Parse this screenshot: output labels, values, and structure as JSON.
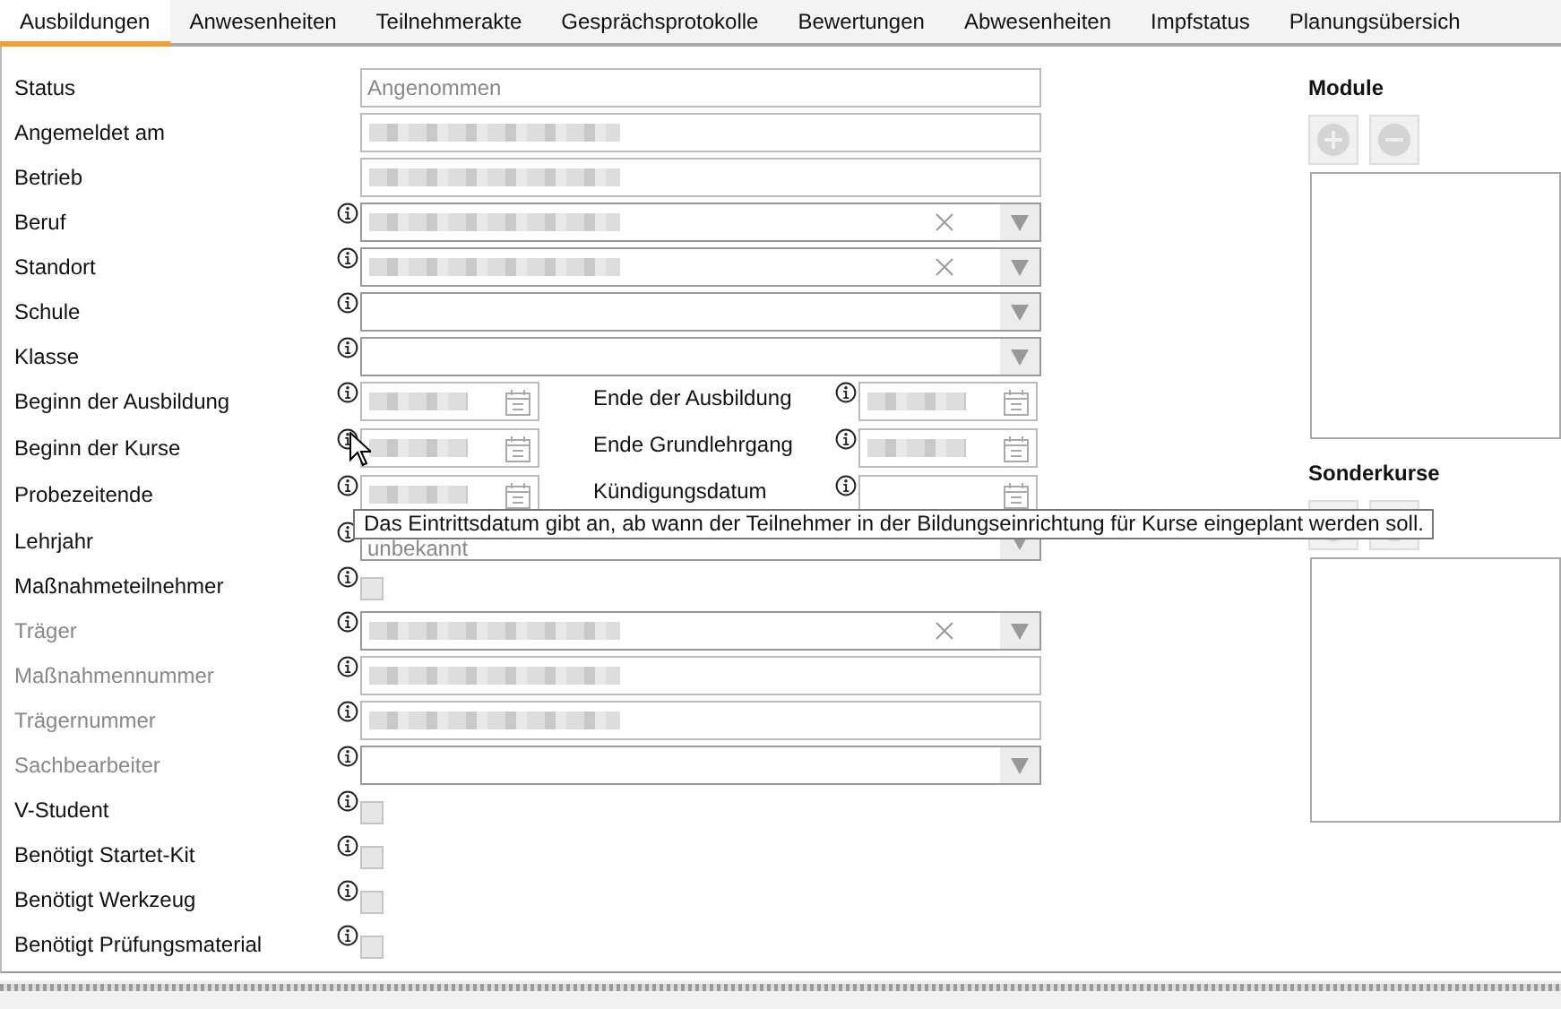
{
  "tabs": [
    {
      "label": "Ausbildungen",
      "selected": true
    },
    {
      "label": "Anwesenheiten",
      "selected": false
    },
    {
      "label": "Teilnehmerakte",
      "selected": false
    },
    {
      "label": "Gesprächsprotokolle",
      "selected": false
    },
    {
      "label": "Bewertungen",
      "selected": false
    },
    {
      "label": "Abwesenheiten",
      "selected": false
    },
    {
      "label": "Impfstatus",
      "selected": false
    },
    {
      "label": "Planungsübersich",
      "selected": false
    }
  ],
  "form": [
    {
      "label": "Status",
      "disabled": false,
      "info": false,
      "field": {
        "kind": "text",
        "value": "Angenommen"
      }
    },
    {
      "label": "Angemeldet am",
      "disabled": false,
      "info": false,
      "field": {
        "kind": "text",
        "redacted": true
      }
    },
    {
      "label": "Betrieb",
      "disabled": false,
      "info": false,
      "field": {
        "kind": "text",
        "redacted": true
      }
    },
    {
      "label": "Beruf",
      "disabled": false,
      "info": true,
      "field": {
        "kind": "combo",
        "redacted": true,
        "clearable": true
      }
    },
    {
      "label": "Standort",
      "disabled": false,
      "info": true,
      "field": {
        "kind": "combo",
        "redacted": true,
        "clearable": true
      }
    },
    {
      "label": "Schule",
      "disabled": false,
      "info": true,
      "field": {
        "kind": "combo"
      }
    },
    {
      "label": "Klasse",
      "disabled": false,
      "info": true,
      "field": {
        "kind": "combo"
      }
    },
    {
      "label": "Beginn der Ausbildung",
      "disabled": false,
      "info": true,
      "field": {
        "kind": "date",
        "redacted": true
      },
      "second": {
        "label": "Ende der Ausbildung",
        "info": true,
        "field": {
          "kind": "date",
          "redacted": true
        }
      }
    },
    {
      "label": "Beginn der Kurse",
      "disabled": false,
      "info": true,
      "field": {
        "kind": "date",
        "redacted": true
      },
      "second": {
        "label": "Ende Grundlehrgang",
        "info": true,
        "field": {
          "kind": "date",
          "redacted": true
        }
      }
    },
    {
      "label": "Probezeitende",
      "disabled": false,
      "info": true,
      "field": {
        "kind": "date",
        "redacted": true
      },
      "second": {
        "label": "Kündigungsdatum",
        "info": true,
        "field": {
          "kind": "date"
        }
      }
    },
    {
      "label": "Lehrjahr",
      "disabled": false,
      "info": true,
      "field": {
        "kind": "combo",
        "value": "unbekannt"
      }
    },
    {
      "label": "Maßnahmeteilnehmer",
      "disabled": false,
      "info": true,
      "field": {
        "kind": "check",
        "checked": false
      }
    },
    {
      "label": "Träger",
      "disabled": true,
      "info": true,
      "field": {
        "kind": "combo",
        "redacted": true,
        "clearable": true
      }
    },
    {
      "label": "Maßnahmennummer",
      "disabled": true,
      "info": true,
      "field": {
        "kind": "text",
        "redacted": true
      }
    },
    {
      "label": "Trägernummer",
      "disabled": true,
      "info": true,
      "field": {
        "kind": "text",
        "redacted": true
      }
    },
    {
      "label": "Sachbearbeiter",
      "disabled": true,
      "info": true,
      "field": {
        "kind": "combo"
      }
    },
    {
      "label": "V-Student",
      "disabled": false,
      "info": true,
      "field": {
        "kind": "check",
        "checked": false
      }
    },
    {
      "label": "Benötigt Startet-Kit",
      "disabled": false,
      "info": true,
      "field": {
        "kind": "check",
        "checked": false
      }
    },
    {
      "label": "Benötigt Werkzeug",
      "disabled": false,
      "info": true,
      "field": {
        "kind": "check",
        "checked": false
      }
    },
    {
      "label": "Benötigt Prüfungsmaterial",
      "disabled": false,
      "info": true,
      "field": {
        "kind": "check",
        "checked": false
      }
    }
  ],
  "side": [
    {
      "title": "Module"
    },
    {
      "title": "Sonderkurse"
    }
  ],
  "tooltip": {
    "text": "Das Eintrittsdatum gibt an, ab wann der Teilnehmer in der Bildungseinrichtung für Kurse eingeplant werden soll."
  }
}
